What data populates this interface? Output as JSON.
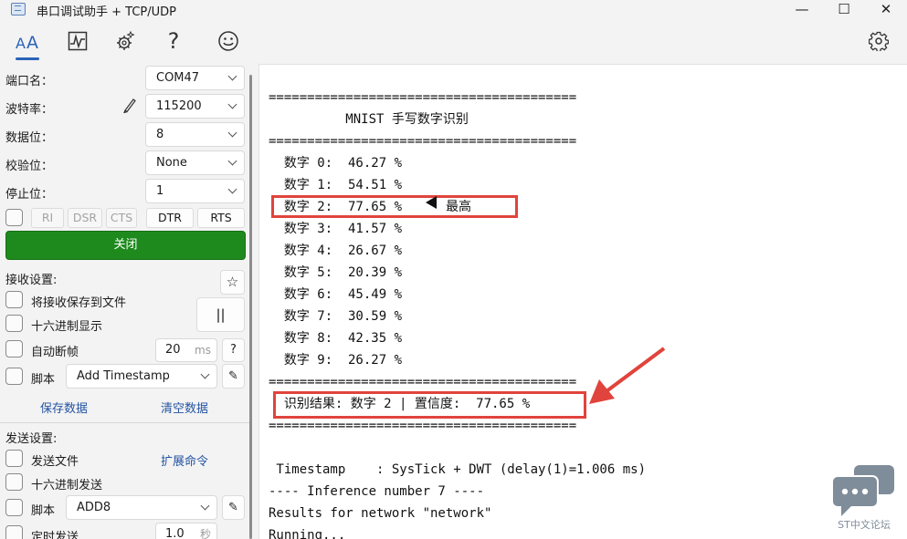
{
  "window": {
    "title": "串口调试助手 + TCP/UDP",
    "minimize_glyph": "—",
    "maximize_glyph": "☐",
    "close_glyph": "✕"
  },
  "toolbar": {
    "icons": [
      "font-icon",
      "waveform-icon",
      "settings-gear-icon",
      "help-icon",
      "smiley-icon",
      "gear-icon"
    ],
    "help_glyph": "?",
    "smiley_glyph": "☺",
    "active_color": "#2a63b8"
  },
  "serial": {
    "port_label": "端口名：",
    "port_value": "COM47",
    "baud_label": "波特率：",
    "baud_value": "115200",
    "databits_label": "数据位：",
    "databits_value": "8",
    "parity_label": "校验位：",
    "parity_value": "None",
    "stopbits_label": "停止位：",
    "stopbits_value": "1",
    "signals": [
      "RI",
      "DSR",
      "CTS",
      "DTR",
      "RTS"
    ],
    "close_label": "关闭",
    "close_color": "#1e8a1e"
  },
  "receive": {
    "section_label": "接收设置:",
    "pin_glyph": "☆",
    "save_to_file": "将接收保存到文件",
    "hex_display": "十六进制显示",
    "pause_glyph": "||",
    "auto_frame": "自动断帧",
    "frame_value": "20",
    "frame_unit": "ms",
    "frame_help": "?",
    "script_label": "脚本",
    "script_value": "Add Timestamp",
    "edit_glyph": "✎",
    "save_data": "保存数据",
    "clear_data": "清空数据"
  },
  "send": {
    "section_label": "发送设置:",
    "send_file": "发送文件",
    "ext_cmd": "扩展命令",
    "hex_send": "十六进制发送",
    "script_label": "脚本",
    "script_value": "ADD8",
    "edit_glyph": "✎",
    "timed_send": "定时发送",
    "timed_value": "1.0",
    "timed_unit": "秒"
  },
  "terminal": {
    "lines": [
      "========================================",
      "          MNIST 手写数字识别",
      "========================================",
      "  数字 0:  46.27 %",
      "  数字 1:  54.51 %",
      "  数字 2:  77.65 %",
      "  数字 3:  41.57 %",
      "  数字 4:  26.67 %",
      "  数字 5:  20.39 %",
      "  数字 6:  45.49 %",
      "  数字 7:  30.59 %",
      "  数字 8:  42.35 %",
      "  数字 9:  26.27 %",
      "========================================",
      "  识别结果: 数字 2 | 置信度:  77.65 %",
      "========================================",
      "",
      " Timestamp    : SysTick + DWT (delay(1)=1.006 ms)",
      "---- Inference number 7 ----",
      "Results for network \"network\"",
      "Running..."
    ],
    "highlight_label": "最高",
    "highlight_color": "#e0443c"
  },
  "watermark": {
    "text": "ST中文论坛",
    "color": "#7f8c99"
  }
}
